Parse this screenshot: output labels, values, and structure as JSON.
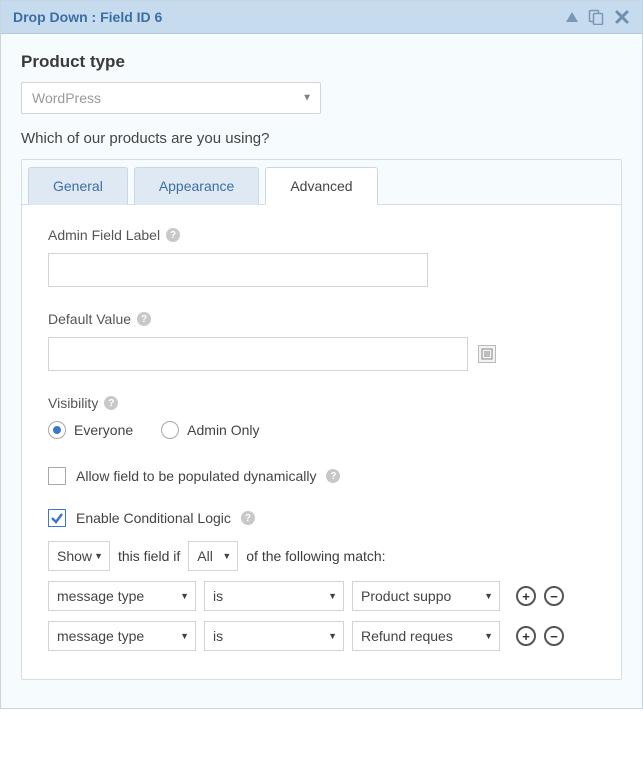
{
  "header": {
    "title": "Drop Down : Field ID 6"
  },
  "field": {
    "title": "Product type",
    "select_value": "WordPress",
    "description": "Which of our products are you using?"
  },
  "tabs": [
    {
      "label": "General",
      "active": false
    },
    {
      "label": "Appearance",
      "active": false
    },
    {
      "label": "Advanced",
      "active": true
    }
  ],
  "advanced": {
    "admin_label": {
      "label": "Admin Field Label",
      "value": ""
    },
    "default_value": {
      "label": "Default Value",
      "value": ""
    },
    "visibility": {
      "label": "Visibility",
      "options": [
        {
          "label": "Everyone",
          "checked": true
        },
        {
          "label": "Admin Only",
          "checked": false
        }
      ]
    },
    "dynamic": {
      "label": "Allow field to be populated dynamically",
      "checked": false
    },
    "conditional": {
      "enable_label": "Enable Conditional Logic",
      "enabled": true,
      "showhide": "Show",
      "text_mid": "this field if",
      "anyall": "All",
      "text_end": "of the following match:",
      "rules": [
        {
          "field": "message type",
          "op": "is",
          "value": "Product suppo"
        },
        {
          "field": "message type",
          "op": "is",
          "value": "Refund reques"
        }
      ]
    }
  }
}
